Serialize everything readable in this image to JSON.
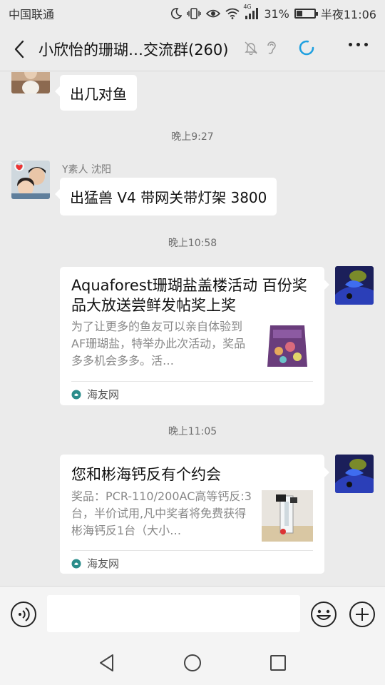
{
  "status": {
    "carrier": "中国联通",
    "network": "4G",
    "battery": "31%",
    "battery_level": 0.31,
    "time": "半夜11:06"
  },
  "header": {
    "title": "小欣怡的珊瑚…交流群(260)"
  },
  "messages": [
    {
      "type": "text",
      "text": "出几对鱼"
    },
    {
      "type": "time",
      "text": "晚上9:27"
    },
    {
      "type": "text",
      "sender": "Y素人 沈阳",
      "text": "出猛兽 V4 带网关带灯架 3800"
    },
    {
      "type": "time",
      "text": "晚上10:58"
    },
    {
      "type": "card",
      "title": "Aquaforest珊瑚盐盖楼活动 百份奖品大放送尝鲜发帖奖上奖",
      "desc": "为了让更多的鱼友可以亲自体验到AF珊瑚盐，特举办此次活动，奖品多多机会多多。活…",
      "source": "海友网"
    },
    {
      "type": "time",
      "text": "晚上11:05"
    },
    {
      "type": "card",
      "title": "您和彬海钙反有个约会",
      "desc": "奖品：PCR-110/200AC高等钙反:3台，半价试用,凡中奖者将免费获得彬海钙反1台（大小…",
      "source": "海友网"
    }
  ],
  "icons": {
    "back": "back-arrow-icon",
    "mute": "bell-off-icon",
    "ear": "ear-icon",
    "loading": "loading-spinner-icon",
    "more": "more-dots-icon",
    "voice": "voice-input-icon",
    "emoji": "emoji-icon",
    "plus": "plus-icon"
  },
  "colors": {
    "spinner": "#1fa0e0",
    "source_logo": "#2a8c8a"
  }
}
